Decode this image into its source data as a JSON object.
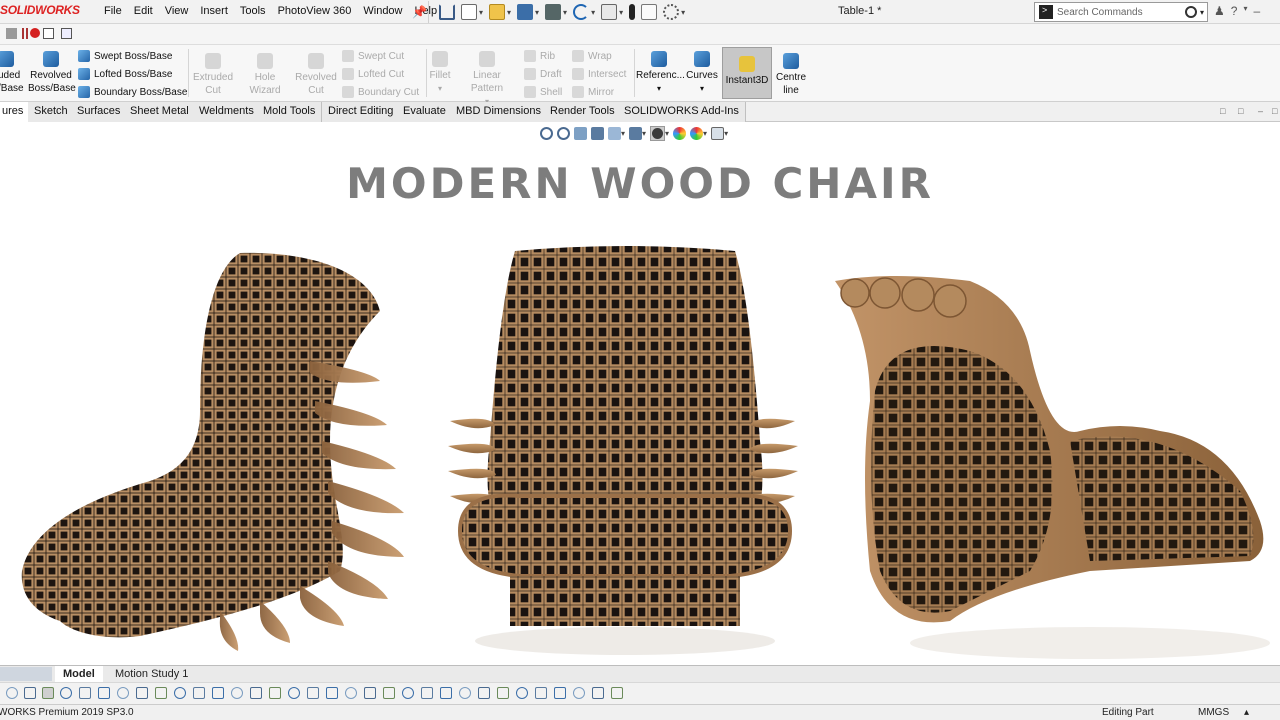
{
  "app": {
    "logo": "SOLIDWORKS",
    "doc_title": "Table-1 *"
  },
  "menu": [
    "File",
    "Edit",
    "View",
    "Insert",
    "Tools",
    "PhotoView 360",
    "Window",
    "Help"
  ],
  "search": {
    "placeholder": "Search Commands"
  },
  "ribbon": {
    "extruded": "uded\n/Base",
    "revolved_boss": "Revolved\nBoss/Base",
    "swept_boss": "Swept Boss/Base",
    "lofted_boss": "Lofted Boss/Base",
    "boundary_boss": "Boundary Boss/Base",
    "extruded_cut": "Extruded\nCut",
    "hole_wizard": "Hole Wizard",
    "revolved_cut": "Revolved\nCut",
    "swept_cut": "Swept Cut",
    "lofted_cut": "Lofted Cut",
    "boundary_cut": "Boundary Cut",
    "fillet": "Fillet",
    "linear_pattern": "Linear Pattern",
    "rib": "Rib",
    "draft": "Draft",
    "shell": "Shell",
    "wrap": "Wrap",
    "intersect": "Intersect",
    "mirror": "Mirror",
    "reference": "Referenc...",
    "curves": "Curves",
    "instant3d": "Instant3D",
    "centreline": "Centre\nline"
  },
  "tabs": [
    "ures",
    "Sketch",
    "Surfaces",
    "Sheet Metal",
    "Weldments",
    "Mold Tools",
    "Direct Editing",
    "Evaluate",
    "MBD Dimensions",
    "Render Tools",
    "SOLIDWORKS Add-Ins"
  ],
  "graphics": {
    "headline": "MODERN WOOD CHAIR"
  },
  "bottom_tabs": {
    "model": "Model",
    "motion": "Motion Study 1"
  },
  "status": {
    "version": "WORKS Premium 2019 SP3.0",
    "mode": "Editing Part",
    "units": "MMGS"
  },
  "colors": {
    "wood_dark": "#6b4a2c",
    "wood_light": "#b88e64",
    "logo_red": "#d22222",
    "headline": "#7d7d7d"
  }
}
